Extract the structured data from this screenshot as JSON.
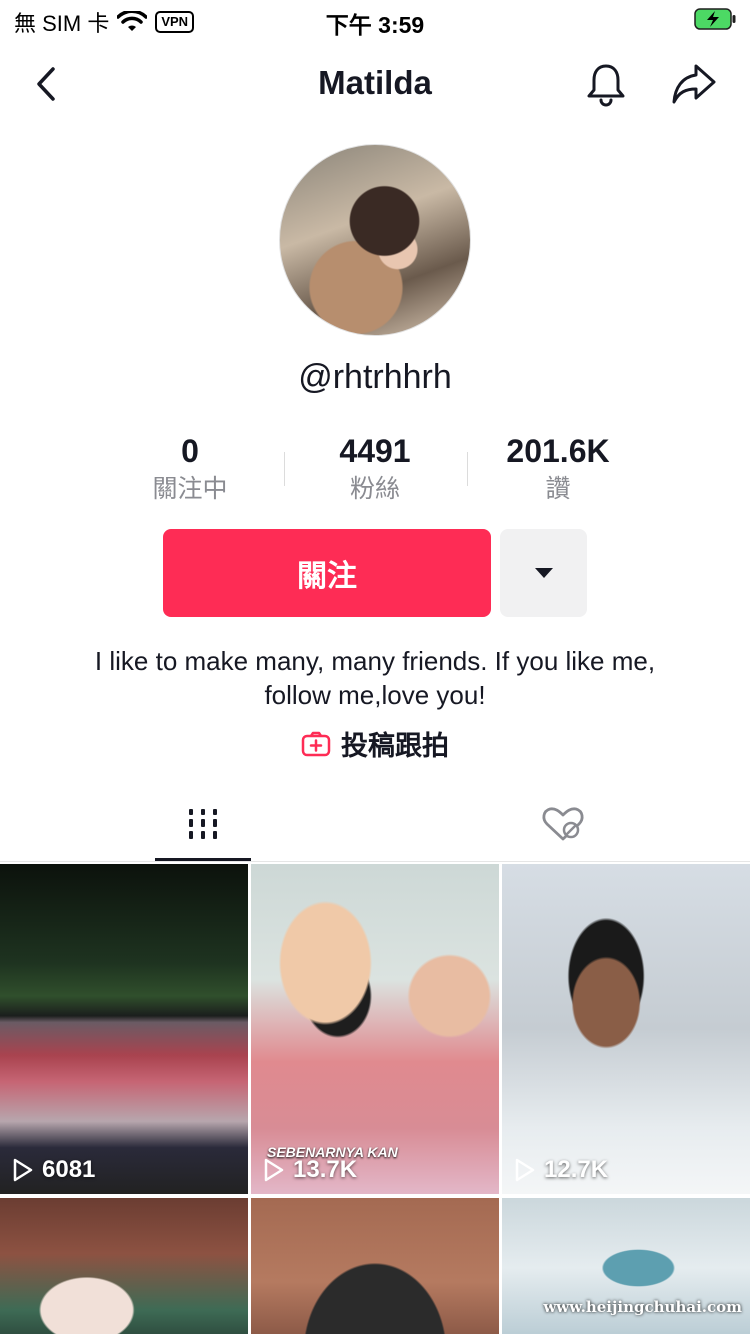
{
  "status_bar": {
    "carrier": "無 SIM 卡",
    "vpn": "VPN",
    "time": "下午 3:59"
  },
  "nav": {
    "title": "Matilda",
    "back_icon": "chevron-left-icon",
    "bell_icon": "bell-icon",
    "share_icon": "share-arrow-icon"
  },
  "profile": {
    "handle": "@rhtrhhrh",
    "bio": "I like to make many, many friends. If you like me, follow me,love you!",
    "stats": [
      {
        "value": "0",
        "label": "關注中"
      },
      {
        "value": "4491",
        "label": "粉絲"
      },
      {
        "value": "201.6K",
        "label": "讚"
      }
    ],
    "follow_label": "關注",
    "collab_label": "投稿跟拍"
  },
  "tabs": [
    {
      "icon": "videos-grid-icon",
      "active": true
    },
    {
      "icon": "liked-hidden-icon",
      "active": false
    }
  ],
  "videos": [
    {
      "views": "6081"
    },
    {
      "views": "13.7K",
      "caption": "SEBENARNYA KAN"
    },
    {
      "views": "12.7K"
    },
    {
      "views": ""
    },
    {
      "views": ""
    },
    {
      "views": ""
    }
  ],
  "watermark": "www.heijingchuhai.com",
  "colors": {
    "accent": "#fe2c55",
    "text": "#161823",
    "muted": "#8a8b91",
    "secondary_button": "#f1f1f2"
  }
}
